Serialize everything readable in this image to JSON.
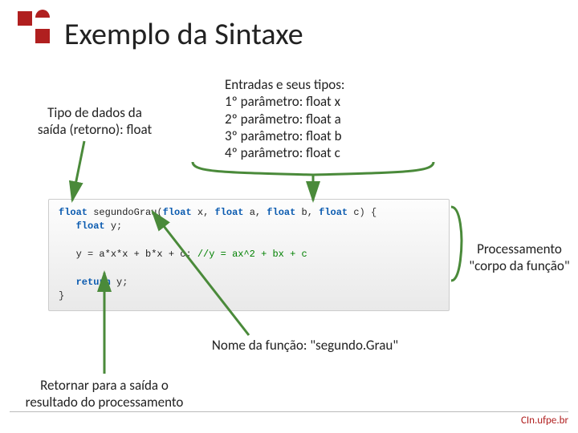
{
  "title": "Exemplo da Sintaxe",
  "annotations": {
    "left": {
      "line1": "Tipo de dados da",
      "line2": "saída (retorno): float"
    },
    "top": {
      "line1": "Entradas e seus tipos:",
      "line2": "1º parâmetro: float x",
      "line3": "2º parâmetro: float a",
      "line4": "3º parâmetro: float b",
      "line5": "4º parâmetro: float c"
    },
    "right": {
      "line1": "Processamento",
      "line2": "\"corpo da função\""
    },
    "bottomName": "Nome da função: \"segundo.Grau\"",
    "bottomReturn": {
      "line1": "Retornar para a saída o",
      "line2": "resultado do processamento"
    }
  },
  "code": {
    "kw_float": "float",
    "fn_name": "segundoGrau",
    "p1": "x",
    "p2": "a",
    "p3": "b",
    "p4": "c",
    "decl_var": "y",
    "assign_lhs": "y",
    "expr": "a*x*x + b*x + c",
    "comment": "//y = ax^2 + bx + c",
    "ret_kw": "return",
    "ret_val": "y"
  },
  "footer": "CIn.ufpe.br"
}
